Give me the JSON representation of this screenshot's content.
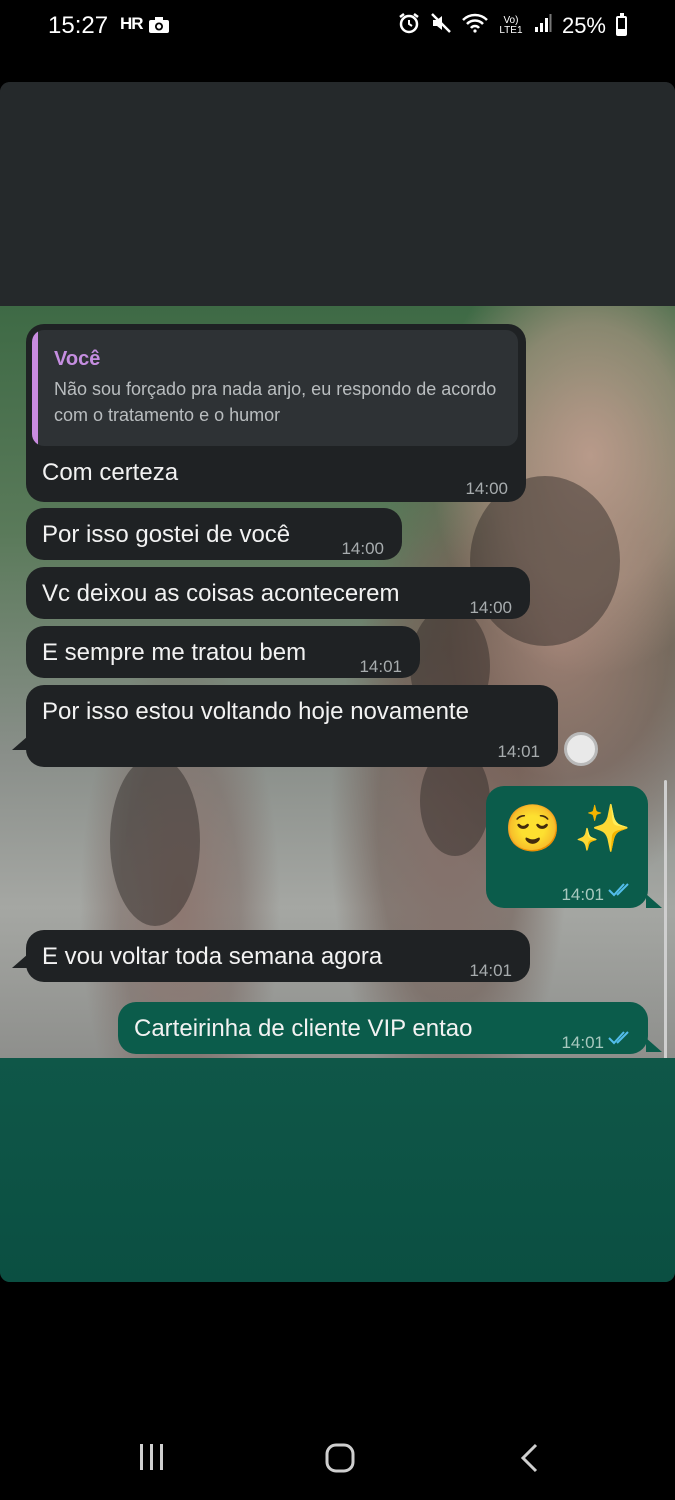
{
  "status_bar": {
    "time": "15:27",
    "hr_label": "HR",
    "volte_label": "Vo) LTE1",
    "battery": "25%",
    "battery_level": 0.25
  },
  "quoted_message": {
    "author": "Você",
    "text": "Não sou forçado pra nada anjo, eu respondo de acordo com o tratamento e o humor"
  },
  "messages": [
    {
      "direction": "in",
      "text": "Com certeza",
      "time": "14:00"
    },
    {
      "direction": "in",
      "text": "Por isso gostei de você",
      "time": "14:00"
    },
    {
      "direction": "in",
      "text": "Vc deixou as coisas acontecerem",
      "time": "14:00"
    },
    {
      "direction": "in",
      "text": "E sempre me tratou bem",
      "time": "14:01"
    },
    {
      "direction": "in",
      "text": "Por isso estou voltando hoje novamente",
      "time": "14:01"
    },
    {
      "direction": "out",
      "text": "😌 ✨",
      "time": "14:01",
      "read": true
    },
    {
      "direction": "in",
      "text": "E vou voltar toda semana agora",
      "time": "14:01"
    },
    {
      "direction": "out",
      "text": "Carteirinha de cliente VIP entao",
      "time": "14:01",
      "read": true
    }
  ],
  "colors": {
    "incoming_bubble": "#1f2224",
    "outgoing_bubble": "#0b5c4b",
    "quote_accent": "#c98be0",
    "read_tick": "#53bdeb"
  },
  "nav_bar": {
    "recents_icon": "recents-icon",
    "home_icon": "home-icon",
    "back_icon": "back-icon"
  }
}
